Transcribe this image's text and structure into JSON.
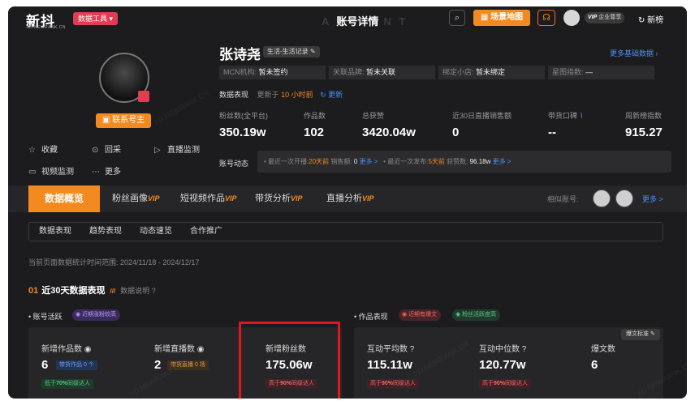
{
  "header": {
    "logo": "新抖",
    "logo_sub": "XD.NEWRANK.CN",
    "tools_label": "数据工具 ▾",
    "title": "账号详情",
    "title_ghost_left": "A",
    "title_ghost_right": "N T",
    "map_label": "场景地图",
    "vip_label": "企业尊享",
    "vip_tag": "VIP",
    "new_list_label": "新榜"
  },
  "profile": {
    "name": "张诗尧",
    "category": "生活-生活记录",
    "contact_label": "联系号主",
    "more_basic": "更多基础数据",
    "actions": {
      "collect": "收藏",
      "replay": "回采",
      "live_monitor": "直播监测",
      "video_monitor": "视频监测",
      "more": "更多"
    },
    "info": {
      "mcn_label": "MCN机构:",
      "mcn_value": "暂未签约",
      "brand_label": "关联品牌:",
      "brand_value": "暂未关联",
      "shop_label": "绑定小店:",
      "shop_value": "暂未绑定",
      "star_label": "星图指数:",
      "star_value": "—"
    }
  },
  "performance": {
    "label": "数据表现",
    "updated_prefix": "更新于",
    "updated_time": "10 小时前",
    "refresh": "更新"
  },
  "stats": [
    {
      "label": "粉丝数(全平台)",
      "value": "350.19w"
    },
    {
      "label": "作品数",
      "value": "102"
    },
    {
      "label": "总获赞",
      "value": "3420.04w"
    },
    {
      "label": "近30日直播销售额",
      "value": "0"
    },
    {
      "label": "带货口碑",
      "value": "--"
    },
    {
      "label": "周新榜指数",
      "value": "915.27"
    }
  ],
  "dynamics": {
    "label": "账号动态",
    "live_prefix": "最近一次开播:",
    "live_days": "20天前",
    "sales_label": "销售额:",
    "sales_value": "0",
    "more1": "更多 >",
    "post_prefix": "最近一次发布:",
    "post_days": "5天前",
    "likes_label": "获赞数:",
    "likes_value": "96.18w",
    "more2": "更多 >"
  },
  "tabs": {
    "overview": "数据概览",
    "fans": "粉丝画像",
    "videos": "短视频作品",
    "goods": "带货分析",
    "live": "直播分析",
    "vip": "VIP",
    "similar": "相似账号:",
    "more": "更多 >"
  },
  "subtabs": [
    "数据表现",
    "趋势表现",
    "动态速览",
    "合作推广"
  ],
  "range_text": "当前页面数据统计时间范围: 2024/11/18 - 2024/12/17",
  "section": {
    "num": "01",
    "title": "近30天数据表现",
    "note": "数据说明"
  },
  "activity": {
    "label": "账号活跃",
    "pill": "近期涨粉较高"
  },
  "works": {
    "label": "作品表现",
    "pill1": "近期有爆文",
    "pill2": "粉丝活跃度高",
    "std_btn": "爆文标准"
  },
  "metrics_left": [
    {
      "label": "新增作品数",
      "value": "6",
      "tag": "带货作品 0 个",
      "foot_prefix": "低于",
      "foot_pct": "70%",
      "foot_suffix": "同级达人"
    },
    {
      "label": "新增直播数",
      "value": "2",
      "tag": "带货直播 0 场"
    },
    {
      "label": "新增粉丝数",
      "value": "175.06w",
      "foot_prefix": "高于",
      "foot_pct": "90%",
      "foot_suffix": "同级达人"
    }
  ],
  "metrics_right": [
    {
      "label": "互动平均数",
      "value": "115.11w",
      "foot_prefix": "高于",
      "foot_pct": "90%",
      "foot_suffix": "同级达人"
    },
    {
      "label": "互动中位数",
      "value": "120.77w",
      "foot_prefix": "高于",
      "foot_pct": "90%",
      "foot_suffix": "同级达人"
    },
    {
      "label": "爆文数",
      "value": "6"
    }
  ],
  "watermark": "XD.NEWRANK.CN",
  "colors": {
    "accent": "#f38a1f",
    "brand_red": "#e03c54",
    "link": "#4d8df5",
    "highlight": "#e5141b"
  }
}
